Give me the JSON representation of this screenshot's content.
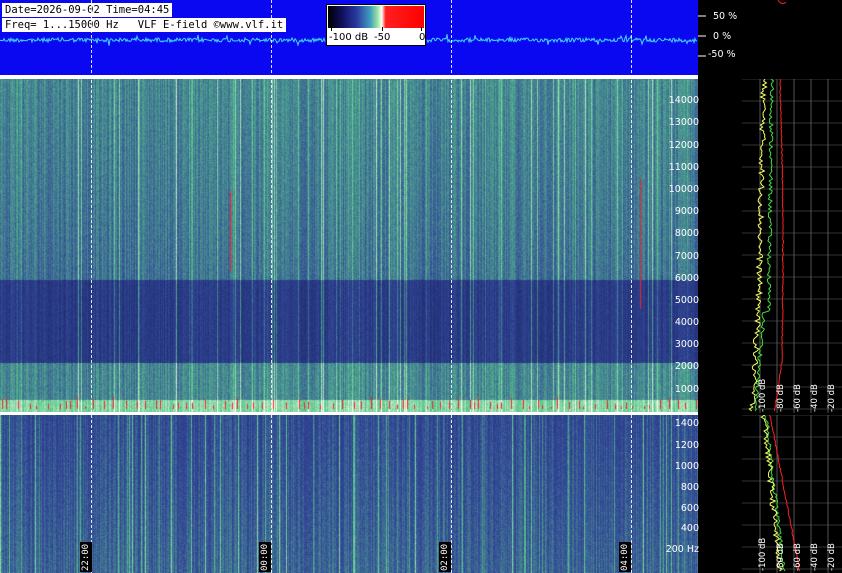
{
  "header": {
    "line1": "Date=2026-09-02 Time=04:45",
    "line2": "Freq= 1...15000 Hz   VLF E-field ©www.vlf.it"
  },
  "colorbar": {
    "labels": [
      "-100 dB",
      "-50",
      "0"
    ]
  },
  "amplitude_scale": [
    "50 %",
    "0 %",
    "-50 %"
  ],
  "freq_axis_high": [
    "14000",
    "13000",
    "12000",
    "11000",
    "10000",
    "9000",
    "8000",
    "7000",
    "6000",
    "5000",
    "4000",
    "3000",
    "2000",
    "1000"
  ],
  "freq_axis_low": [
    "1400",
    "1200",
    "1000",
    "800",
    "600",
    "400",
    "200 Hz"
  ],
  "profile_db_labels_high": [
    "-100 dB",
    "-80 dB",
    "-60 dB",
    "-40 dB",
    "-20 dB"
  ],
  "profile_db_labels_low": [
    "-100 dB",
    "-80 dB",
    "-60 dB",
    "-40 dB",
    "-20 dB"
  ],
  "time_labels": [
    "22:00",
    "00:00",
    "02:00",
    "04:00"
  ],
  "colors": {
    "header_bg": "#0a08f0",
    "trace": "#40d8ff",
    "profile_yellow": "#f4ff60",
    "profile_green": "#40e040",
    "profile_red": "#ff2020"
  }
}
